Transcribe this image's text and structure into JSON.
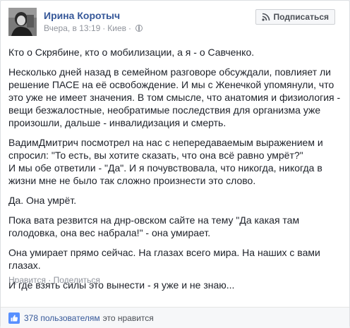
{
  "post": {
    "author": "Ирина Коротыч",
    "time": "Вчера, в 13:19",
    "location": "Киев",
    "subscribe_label": "Подписаться",
    "paragraphs": [
      "Кто о Скрябине, кто о мобилизации, а я - о Савченко.",
      "Несколько дней назад в семейном разговоре обсуждали, повлияет ли решение ПАСЕ на её освобождение. И мы с Женечкой упомянули, что это уже не имеет значения. В том смысле, что анатомия и физиология - вещи безжалостные, необратимые последствия для организма уже произошли, дальше - инвалидизация и смерть.",
      "ВадимДмитрич посмотрел на нас с непередаваемым выражением и спросил: \"То есть, вы хотите сказать, что она всё равно умрёт?\"\nИ мы обе ответили - \"Да\". И я почувствовала, что никогда, никогда в жизни мне не было так сложно произнести это слово.",
      "Да. Она умрёт.",
      "Пока вата резвится на днр-овском сайте на тему \"Да какая там голодовка, она вес набрала!\" - она умирает.",
      "Она умирает прямо сейчас. На глазах всего мира. На наших с вами глазах.",
      "И где взять силы это вынести - я уже и не знаю..."
    ],
    "actions": {
      "like": "Нравится",
      "separator": "·",
      "share": "Поделиться"
    },
    "likes": {
      "count_text": "378 пользователям",
      "suffix": "это нравится"
    }
  }
}
